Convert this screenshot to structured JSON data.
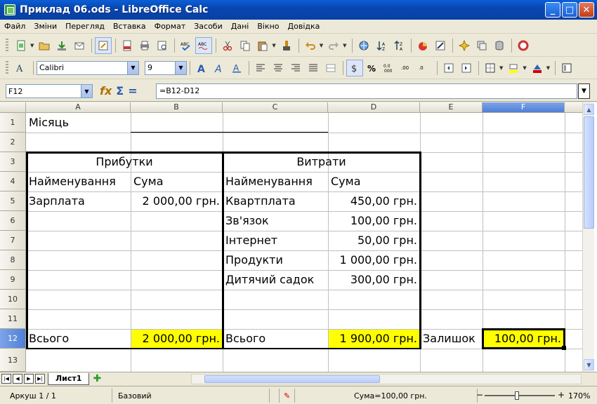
{
  "window": {
    "title": "Приклад 06.ods - LibreOffice Calc",
    "minimize": "_",
    "maximize": "□",
    "close": "✕"
  },
  "menu": [
    "Файл",
    "Зміни",
    "Перегляд",
    "Вставка",
    "Формат",
    "Засоби",
    "Дані",
    "Вікно",
    "Довідка"
  ],
  "formatting": {
    "font_name": "Calibri",
    "font_size": "9"
  },
  "formula_bar": {
    "cell_ref": "F12",
    "formula": "=B12-D12"
  },
  "columns": [
    "A",
    "B",
    "C",
    "D",
    "E",
    "F"
  ],
  "selected_column": "F",
  "rows": [
    "1",
    "2",
    "3",
    "4",
    "5",
    "6",
    "7",
    "8",
    "9",
    "10",
    "11",
    "12",
    "13"
  ],
  "selected_row": "12",
  "cells": {
    "A1": "Місяць",
    "A3": "Прибутки",
    "C3": "Витрати",
    "A4": "Найменування",
    "B4": "Сума",
    "C4": "Найменування",
    "D4": "Сума",
    "A5": "Зарплата",
    "B5": "2 000,00 грн.",
    "C5": "Квартплата",
    "D5": "450,00 грн.",
    "C6": "Зв'язок",
    "D6": "100,00 грн.",
    "C7": "Інтернет",
    "D7": "50,00 грн.",
    "C8": "Продукти",
    "D8": "1 000,00 грн.",
    "C9": "Дитячий садок",
    "D9": "300,00 грн.",
    "A12": "Всього",
    "B12": "2 000,00 грн.",
    "C12": "Всього",
    "D12": "1 900,00 грн.",
    "E12": "Залишок",
    "F12": "100,00 грн."
  },
  "sheets": {
    "active": "Лист1"
  },
  "status": {
    "sheet_info": "Аркуш 1 / 1",
    "style": "Базовий",
    "sum": "Сума=100,00 грн.",
    "zoom": "170%"
  },
  "colors": {
    "highlight": "#ffff00",
    "selection": "#4f7fd6"
  }
}
